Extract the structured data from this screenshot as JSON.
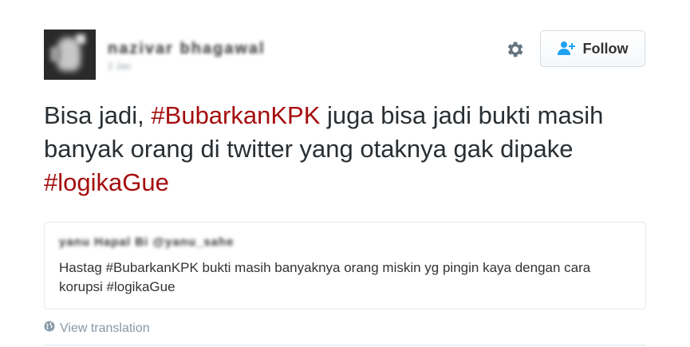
{
  "author": {
    "display_name": "nazivar bhagawal",
    "timestamp": "2 Jan"
  },
  "follow_button": {
    "label": "Follow"
  },
  "tweet": {
    "segments": [
      "Bisa jadi, ",
      "#BubarkanKPK",
      " juga bisa jadi bukti masih banyak orang di twitter yang otaknya gak dipake ",
      "#logikaGue"
    ]
  },
  "quoted_tweet": {
    "author": "yanu Hapal Bi @yanu_sahe",
    "text": "Hastag  #BubarkanKPK bukti masih banyaknya orang miskin yg pingin kaya dengan cara korupsi #logikaGue"
  },
  "translation_link": {
    "label": "View translation"
  },
  "colors": {
    "hashtag": "#a50d0d",
    "text": "#292f33",
    "muted": "#8899a6",
    "border": "#e1e8ed"
  },
  "icons": {
    "settings": "gear-icon",
    "follow": "add-user-icon",
    "translate": "globe-icon"
  }
}
